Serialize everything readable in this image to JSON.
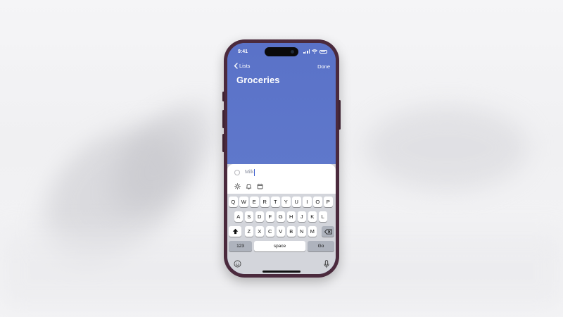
{
  "status_bar": {
    "time": "9:41"
  },
  "nav": {
    "back_label": "Lists",
    "done_label": "Done"
  },
  "list": {
    "title": "Groceries"
  },
  "new_item": {
    "text": "Milk"
  },
  "toolbar_icons": [
    "sun-icon",
    "bell-icon",
    "calendar-icon"
  ],
  "keyboard": {
    "row1": [
      "Q",
      "W",
      "E",
      "R",
      "T",
      "Y",
      "U",
      "I",
      "O",
      "P"
    ],
    "row2": [
      "A",
      "S",
      "D",
      "F",
      "G",
      "H",
      "J",
      "K",
      "L"
    ],
    "row3": [
      "Z",
      "X",
      "C",
      "V",
      "B",
      "N",
      "M"
    ],
    "numbers_label": "123",
    "space_label": "space",
    "go_label": "Go"
  },
  "colors": {
    "list_accent": "#5b74c7",
    "frame": "#4b2a3d"
  }
}
